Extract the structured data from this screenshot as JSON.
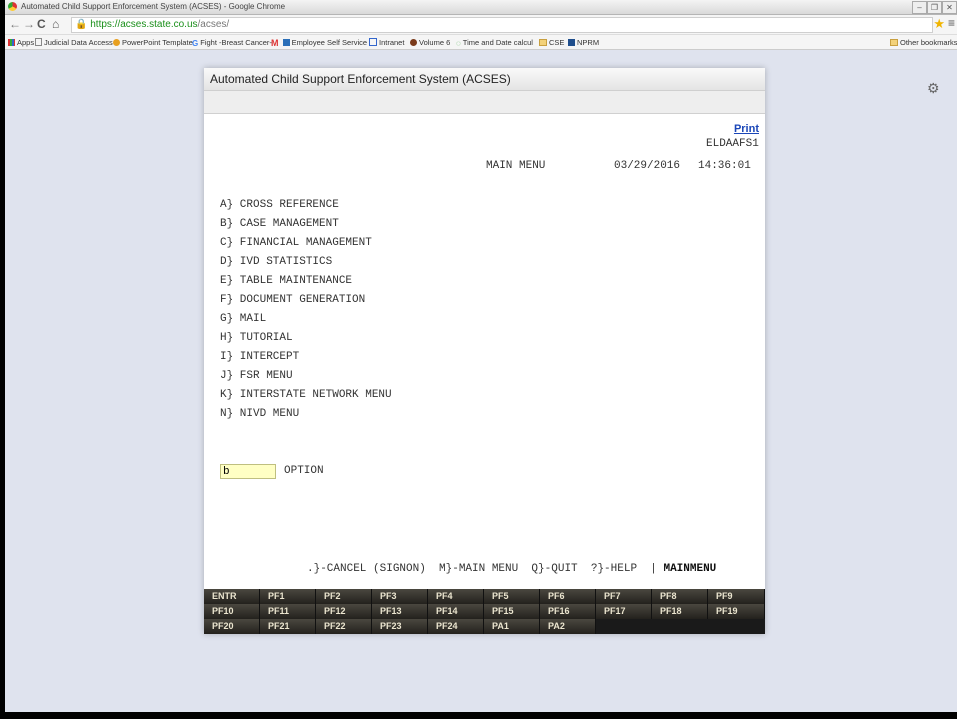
{
  "browser": {
    "window_title": "Automated Child Support Enforcement System (ACSES) - Google Chrome",
    "url_secure": "https://acses.state.co.us",
    "url_path": "/acses/",
    "bookmarks": [
      "Apps",
      "Judicial Data Access",
      "PowerPoint Template",
      "Fight -Breast Cancer-",
      "Employee Self Service",
      "Intranet",
      "Volume 6",
      "Time and Date calcul",
      "CSE",
      "NPRM"
    ],
    "other_bookmarks": "Other bookmarks"
  },
  "app": {
    "title": "Automated Child Support Enforcement System (ACSES)",
    "print_label": "Print",
    "screen_id": "ELDAAFS1",
    "menu_title": "MAIN MENU",
    "date": "03/29/2016",
    "time": "14:36:01",
    "menu_items": [
      "A} CROSS REFERENCE",
      "B} CASE MANAGEMENT",
      "C} FINANCIAL MANAGEMENT",
      "D} IVD STATISTICS",
      "E} TABLE MAINTENANCE",
      "F} DOCUMENT GENERATION",
      "G} MAIL",
      "H} TUTORIAL",
      "I} INTERCEPT",
      "J} FSR MENU",
      "K} INTERSTATE NETWORK MENU",
      "N} NIVD MENU"
    ],
    "option_value": "b",
    "option_label": "OPTION",
    "footer_commands": ".}-CANCEL (SIGNON)  M}-MAIN MENU  Q}-QUIT  ?}-HELP  | ",
    "footer_screen": "MAINMENU"
  },
  "keys": {
    "row1": [
      "ENTR",
      "PF1",
      "PF2",
      "PF3",
      "PF4",
      "PF5",
      "PF6",
      "PF7",
      "PF8",
      "PF9"
    ],
    "row2": [
      "PF10",
      "PF11",
      "PF12",
      "PF13",
      "PF14",
      "PF15",
      "PF16",
      "PF17",
      "PF18",
      "PF19"
    ],
    "row3": [
      "PF20",
      "PF21",
      "PF22",
      "PF23",
      "PF24",
      "PA1",
      "PA2"
    ]
  },
  "icons": {
    "gear": "gear-icon",
    "star": "star-icon",
    "lock": "lock-icon"
  }
}
